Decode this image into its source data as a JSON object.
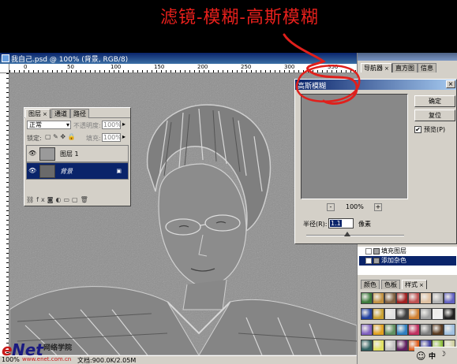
{
  "caption": {
    "text": "滤镜-模糊-高斯模糊",
    "color": "#e8201c"
  },
  "document": {
    "title": "我自己.psd @ 100% (背景, RGB/8)",
    "ruler_labels": [
      "0",
      "50",
      "100",
      "150",
      "200",
      "250",
      "300",
      "350"
    ],
    "status_zoom": "100%",
    "status_doc": "文档:900.0K/2.05M"
  },
  "layers_panel": {
    "tabs": [
      {
        "label": "图层",
        "active": true
      },
      {
        "label": "通道",
        "active": false
      },
      {
        "label": "路径",
        "active": false
      }
    ],
    "blend_mode": "正常",
    "opacity_label": "不透明度:",
    "opacity_value": "100%",
    "lock_label": "锁定:",
    "fill_label": "填充:",
    "fill_value": "100%",
    "layers": [
      {
        "name": "图层 1",
        "selected": false
      },
      {
        "name": "背景",
        "selected": true
      }
    ],
    "footer_icons": [
      "link-icon",
      "fx-icon",
      "mask-icon",
      "adjustment-icon",
      "folder-icon",
      "new-layer-icon",
      "trash-icon"
    ]
  },
  "right_panel": {
    "nav_tabs": [
      {
        "label": "导航器",
        "active": true
      },
      {
        "label": "直方图",
        "active": false
      },
      {
        "label": "信息",
        "active": false
      }
    ],
    "layer_list": [
      {
        "name": "填充图层",
        "selected": false
      },
      {
        "name": "添加杂色",
        "selected": true
      }
    ],
    "style_tabs": [
      {
        "label": "颜色",
        "active": false
      },
      {
        "label": "色板",
        "active": false
      },
      {
        "label": "样式",
        "active": true
      }
    ],
    "swatch_colors": [
      "#3a7a3a",
      "#c09040",
      "#806040",
      "#a02020",
      "#c05050",
      "#e0c0a0",
      "#b0b0b0",
      "#6060c0",
      "#2040a0",
      "#c8a030",
      "#e0e0e0",
      "#404040",
      "#d08030",
      "#a0a0a0",
      "#f0f0f0",
      "#202020",
      "#8060c0",
      "#e0a020",
      "#609060",
      "#3080c0",
      "#c03060",
      "#808080",
      "#5a3a20",
      "#a0c0e0",
      "#306060",
      "#e0e060",
      "#c0c0c0",
      "#602060",
      "#e06020",
      "#4040a0",
      "#90c040",
      "#d0d0a0"
    ]
  },
  "gaussian_blur": {
    "title": "高斯模糊",
    "ok": "确定",
    "reset": "复位",
    "preview_label": "预览(P)",
    "preview_checked": "✔",
    "zoom": "100%",
    "zoom_out": "-",
    "zoom_in": "+",
    "radius_label": "半径(R):",
    "radius_value": "1.1",
    "radius_unit": "像素",
    "radius_slider_fraction": 0.42
  },
  "logo": {
    "e": "e",
    "net": "Net",
    "cn": "网络学院",
    "url": "www.enet.com.cn"
  },
  "tray": {
    "text": "中",
    "icons": [
      "ime-icon",
      "emoticon-icon"
    ]
  }
}
